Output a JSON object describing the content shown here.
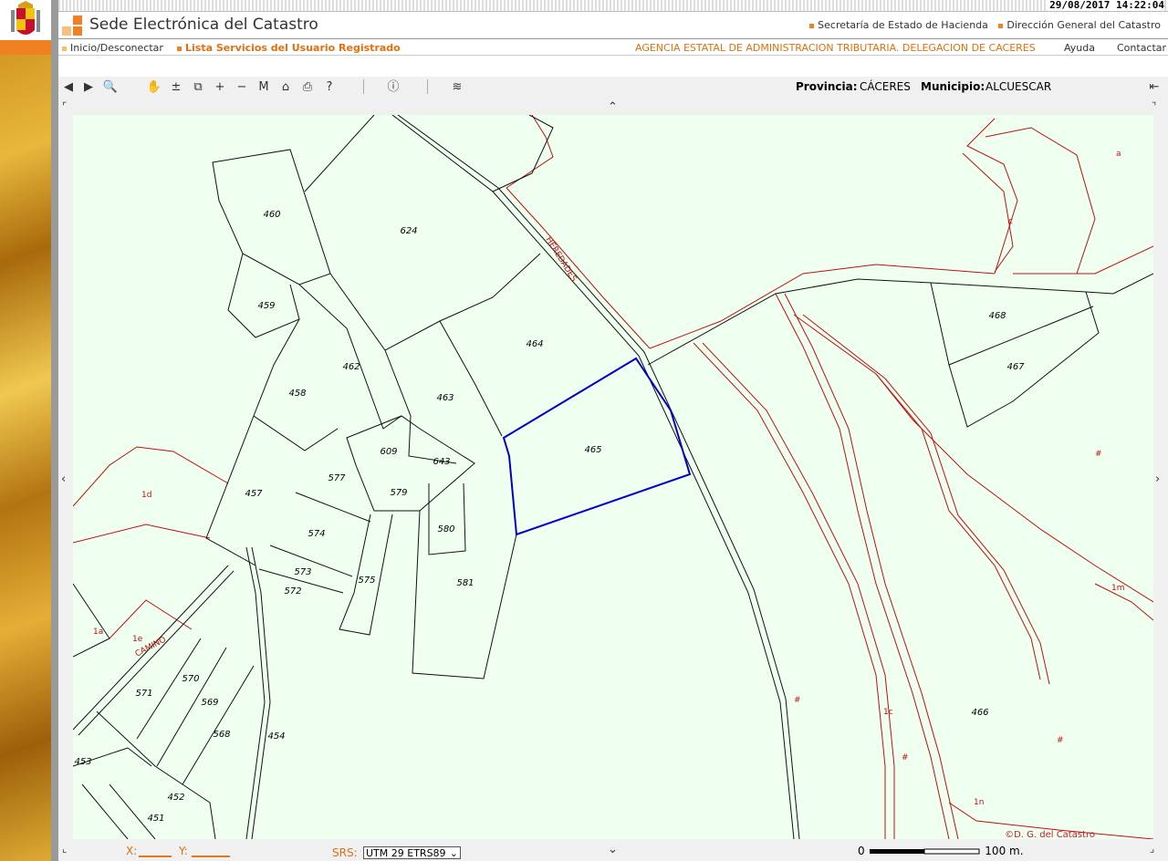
{
  "datetime": "29/08/2017  14:22:04",
  "header": {
    "title": "Sede Electrónica del Catastro",
    "link1": "Secretaría de Estado de Hacienda",
    "link2": "Dirección General del Catastro"
  },
  "nav": {
    "link1": "Inicio/Desconectar",
    "link2": "Lista Servicios del Usuario Registrado",
    "agency": "AGENCIA ESTATAL DE ADMINISTRACION TRIBUTARIA. DELEGACION DE CACERES",
    "ayuda": "Ayuda",
    "contactar": "Contactar"
  },
  "location": {
    "prov_label": "Provincia:",
    "prov": "CÁCERES",
    "mun_label": "Municipio:",
    "mun": "ALCUESCAR"
  },
  "toolbar": {
    "back": "◀",
    "forward": "▶",
    "zoom": "🔍",
    "pan": "✋",
    "zoom_pm": "±",
    "zoom_box": "⧉",
    "zoom_in": "+",
    "zoom_out": "−",
    "measure": "M",
    "home": "⌂",
    "print": "⎙",
    "help": "?",
    "info": "ⓘ",
    "layers": "≋",
    "exit": "⇤"
  },
  "map": {
    "parcels": [
      "460",
      "624",
      "459",
      "464",
      "462",
      "458",
      "463",
      "465",
      "609",
      "643",
      "577",
      "457",
      "579",
      "580",
      "574",
      "573",
      "575",
      "572",
      "581",
      "571",
      "570",
      "569",
      "568",
      "454",
      "453",
      "452",
      "451",
      "468",
      "467",
      "466"
    ],
    "red_labels": [
      "a",
      "c",
      "1d",
      "1a",
      "1e",
      "#",
      "1m",
      "#",
      "#",
      "#",
      "1c",
      "1n"
    ],
    "road_labels": [
      "HEREDADES",
      "CAMINO"
    ],
    "copyright": "©D. G. del Catastro"
  },
  "bottom": {
    "x_label": "X:",
    "x_value": "______",
    "y_label": "Y:",
    "y_value": "_______",
    "srs_label": "SRS:",
    "srs_value": "UTM 29 ETRS89",
    "scale_start": "0",
    "scale_end": "100 m."
  },
  "colors": {
    "accent": "#f08020",
    "map_bg": "#effff0",
    "selected": "#0000cc",
    "red_lines": "#c01010"
  }
}
